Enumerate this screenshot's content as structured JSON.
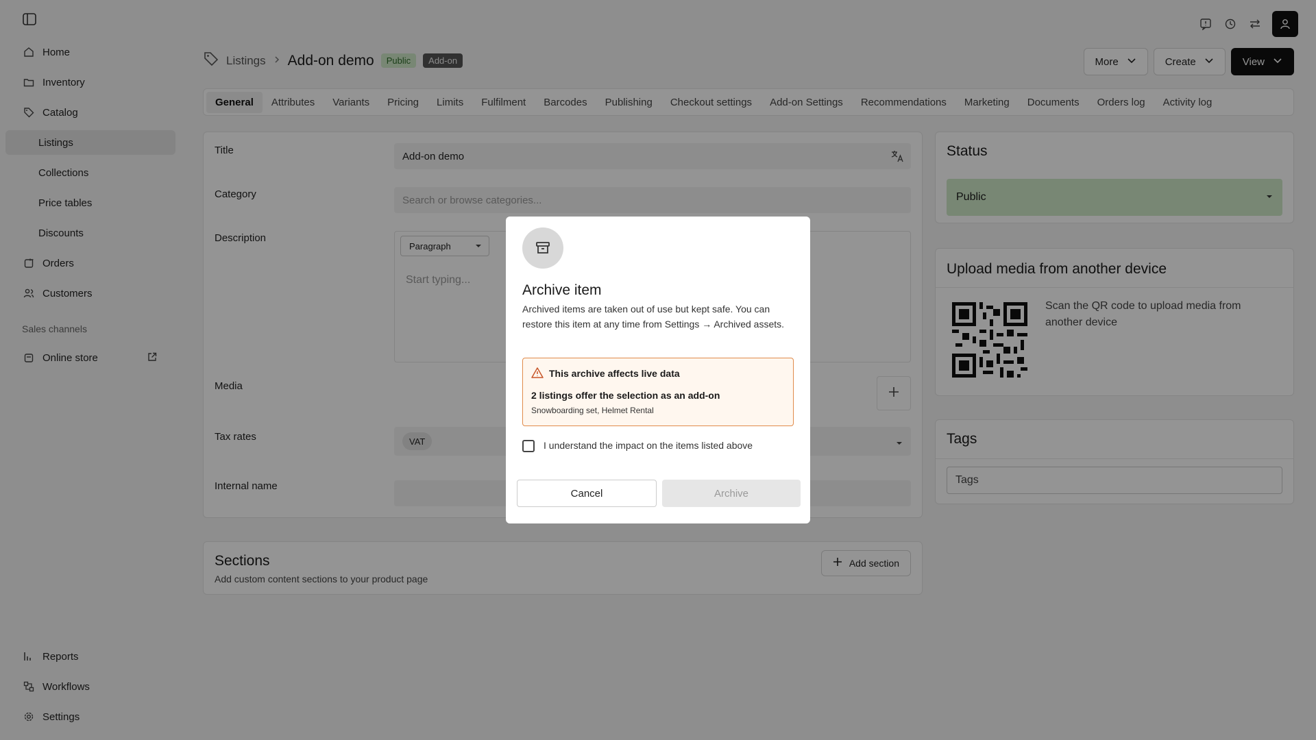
{
  "sidebar": {
    "items": [
      {
        "label": "Home",
        "icon": "home-icon"
      },
      {
        "label": "Inventory",
        "icon": "folder-icon"
      },
      {
        "label": "Catalog",
        "icon": "tag-icon"
      },
      {
        "label": "Listings"
      },
      {
        "label": "Collections"
      },
      {
        "label": "Price tables"
      },
      {
        "label": "Discounts"
      },
      {
        "label": "Orders",
        "icon": "orders-icon"
      },
      {
        "label": "Customers",
        "icon": "users-icon"
      }
    ],
    "channels_heading": "Sales channels",
    "online_store": "Online store",
    "bottom": [
      {
        "label": "Reports",
        "icon": "chart-icon"
      },
      {
        "label": "Workflows",
        "icon": "workflow-icon"
      },
      {
        "label": "Settings",
        "icon": "gear-icon"
      }
    ]
  },
  "header": {
    "breadcrumb": "Listings",
    "title": "Add-on demo",
    "badge_public": "Public",
    "badge_addon": "Add-on",
    "more": "More",
    "create": "Create",
    "view": "View"
  },
  "tabs": [
    "General",
    "Attributes",
    "Variants",
    "Pricing",
    "Limits",
    "Fulfilment",
    "Barcodes",
    "Publishing",
    "Checkout settings",
    "Add-on Settings",
    "Recommendations",
    "Marketing",
    "Documents",
    "Orders log",
    "Activity log"
  ],
  "form": {
    "title_label": "Title",
    "title_value": "Add-on demo",
    "category_label": "Category",
    "category_placeholder": "Search or browse categories...",
    "description_label": "Description",
    "paragraph": "Paragraph",
    "start_typing": "Start typing...",
    "media_label": "Media",
    "tax_label": "Tax rates",
    "tax_chip": "VAT",
    "internal_label": "Internal name"
  },
  "sections": {
    "title": "Sections",
    "subtitle": "Add custom content sections to your product page",
    "add_button": "Add section"
  },
  "status": {
    "title": "Status",
    "value": "Public"
  },
  "upload": {
    "title": "Upload media from another device",
    "text": "Scan the QR code to upload media from another device"
  },
  "tags": {
    "title": "Tags",
    "placeholder": "Tags"
  },
  "modal": {
    "title": "Archive item",
    "description": "Archived items are taken out of use but kept safe. You can restore this item at any time from Settings → Archived assets.",
    "warning_title": "This archive affects live data",
    "warning_line": "2 listings offer the selection as an add-on",
    "warning_sub": "Snowboarding set, Helmet Rental",
    "checkbox_label": "I understand the impact on the items listed above",
    "cancel": "Cancel",
    "archive": "Archive"
  },
  "colors": {
    "overlay": "rgba(0,0,0,0.42)",
    "warning_border": "#e08a4a",
    "status_green": "#cfe8c8"
  }
}
